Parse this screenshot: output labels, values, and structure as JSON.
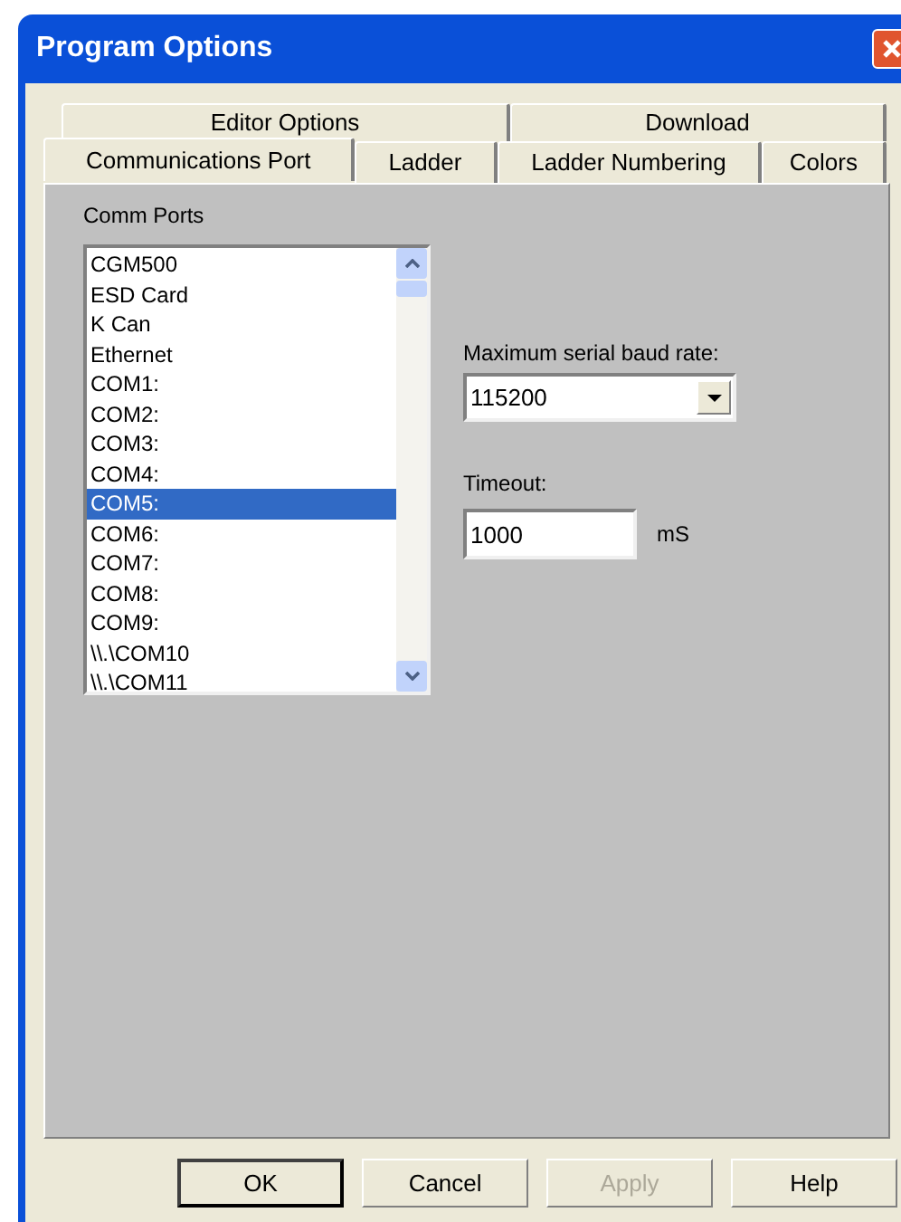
{
  "window": {
    "title": "Program Options"
  },
  "tab_rows": [
    [
      {
        "label": "Editor Options",
        "selected": false
      },
      {
        "label": "Download",
        "selected": false
      }
    ],
    [
      {
        "label": "Communications Port",
        "selected": true
      },
      {
        "label": "Ladder",
        "selected": false
      },
      {
        "label": "Ladder Numbering",
        "selected": false
      },
      {
        "label": "Colors",
        "selected": false
      }
    ]
  ],
  "comm_ports": {
    "label": "Comm Ports",
    "items": [
      {
        "label": "CGM500",
        "selected": false
      },
      {
        "label": "ESD Card",
        "selected": false
      },
      {
        "label": "K Can",
        "selected": false
      },
      {
        "label": "Ethernet",
        "selected": false
      },
      {
        "label": "COM1:",
        "selected": false
      },
      {
        "label": "COM2:",
        "selected": false
      },
      {
        "label": "COM3:",
        "selected": false
      },
      {
        "label": "COM4:",
        "selected": false
      },
      {
        "label": "COM5:",
        "selected": true
      },
      {
        "label": "COM6:",
        "selected": false
      },
      {
        "label": "COM7:",
        "selected": false
      },
      {
        "label": "COM8:",
        "selected": false
      },
      {
        "label": "COM9:",
        "selected": false
      },
      {
        "label": "\\\\.\\COM10",
        "selected": false
      },
      {
        "label": "\\\\.\\COM11",
        "selected": false
      }
    ]
  },
  "baud_rate": {
    "label": "Maximum serial baud rate:",
    "value": "115200"
  },
  "timeout": {
    "label": "Timeout:",
    "value": "1000",
    "unit": "mS"
  },
  "buttons": [
    {
      "label": "OK",
      "default": true,
      "disabled": false
    },
    {
      "label": "Cancel",
      "default": false,
      "disabled": false
    },
    {
      "label": "Apply",
      "default": false,
      "disabled": true
    },
    {
      "label": "Help",
      "default": false,
      "disabled": false
    }
  ]
}
